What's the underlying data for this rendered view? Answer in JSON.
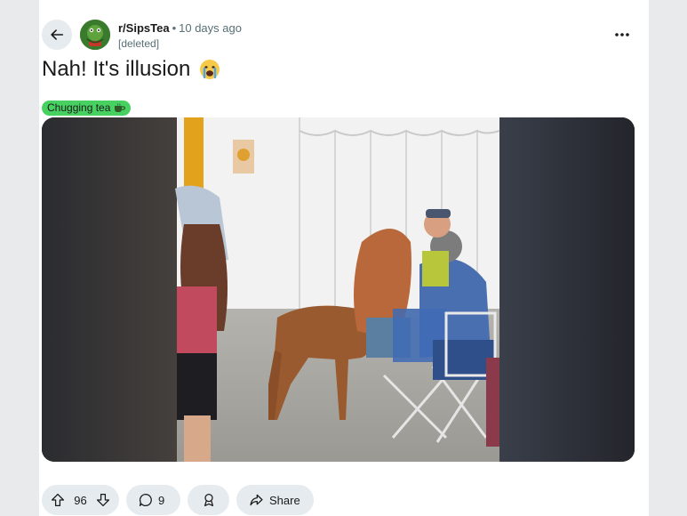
{
  "post": {
    "subreddit": "r/SipsTea",
    "separator": "•",
    "time_ago": "10 days ago",
    "author": "[deleted]",
    "title": "Nah! It's illusion",
    "title_emoji_icon": "crying-face-emoji",
    "flair": {
      "label": "Chugging tea",
      "icon": "tea-cup-icon",
      "color": "#46d160"
    },
    "media_alt_icon": "video-thumbnail-dog-illusion"
  },
  "actions": {
    "upvote_icon": "upvote-arrow-icon",
    "vote_count": "96",
    "downvote_icon": "downvote-arrow-icon",
    "comment_icon": "comment-bubble-icon",
    "comment_count": "9",
    "award_icon": "award-ribbon-icon",
    "share_icon": "share-arrow-icon",
    "share_label": "Share"
  },
  "colors": {
    "pill_bg": "#e5ebee",
    "muted_text": "#576f76",
    "flair_green": "#46d160"
  }
}
